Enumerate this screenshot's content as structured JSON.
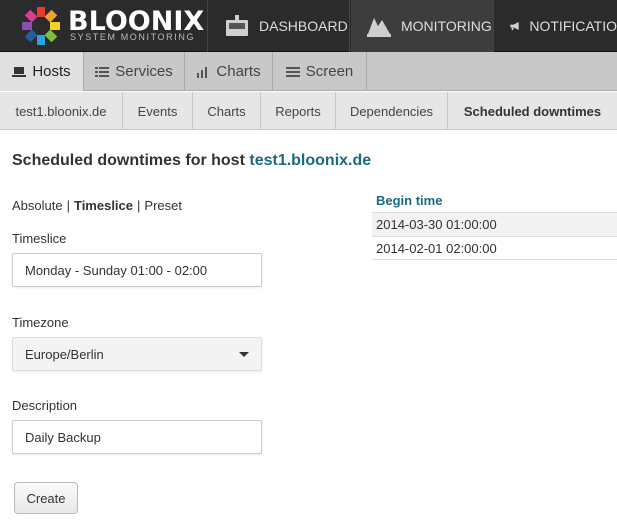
{
  "brand": {
    "title": "BLOONIX",
    "subtitle": "SYSTEM MONITORING"
  },
  "topnav": [
    {
      "label": "DASHBOARD",
      "icon": "dashboard-icon"
    },
    {
      "label": "MONITORING",
      "icon": "monitoring-icon",
      "active": true
    },
    {
      "label": "NOTIFICATIO",
      "icon": "megaphone-icon"
    }
  ],
  "tabs": [
    {
      "label": "Hosts",
      "icon": "laptop-icon",
      "active": true
    },
    {
      "label": "Services",
      "icon": "list-icon"
    },
    {
      "label": "Charts",
      "icon": "bar-chart-icon"
    },
    {
      "label": "Screen",
      "icon": "list-icon"
    }
  ],
  "subtabs": [
    {
      "label": "test1.bloonix.de"
    },
    {
      "label": "Events"
    },
    {
      "label": "Charts"
    },
    {
      "label": "Reports"
    },
    {
      "label": "Dependencies"
    },
    {
      "label": "Scheduled downtimes",
      "active": true
    }
  ],
  "page": {
    "title_prefix": "Scheduled downtimes for host",
    "host": "test1.bloonix.de"
  },
  "modes": {
    "absolute": "Absolute",
    "timeslice": "Timeslice",
    "preset": "Preset",
    "separator": "|"
  },
  "form": {
    "timeslice_label": "Timeslice",
    "timeslice_value": "Monday - Sunday 01:00 - 02:00",
    "timezone_label": "Timezone",
    "timezone_value": "Europe/Berlin",
    "description_label": "Description",
    "description_value": "Daily Backup",
    "create_label": "Create"
  },
  "table": {
    "header": "Begin time",
    "rows": [
      "2014-03-30 01:00:00",
      "2014-02-01 02:00:00"
    ]
  },
  "colors": {
    "accent": "#1a6a80",
    "topbar": "#2b2b2b"
  }
}
